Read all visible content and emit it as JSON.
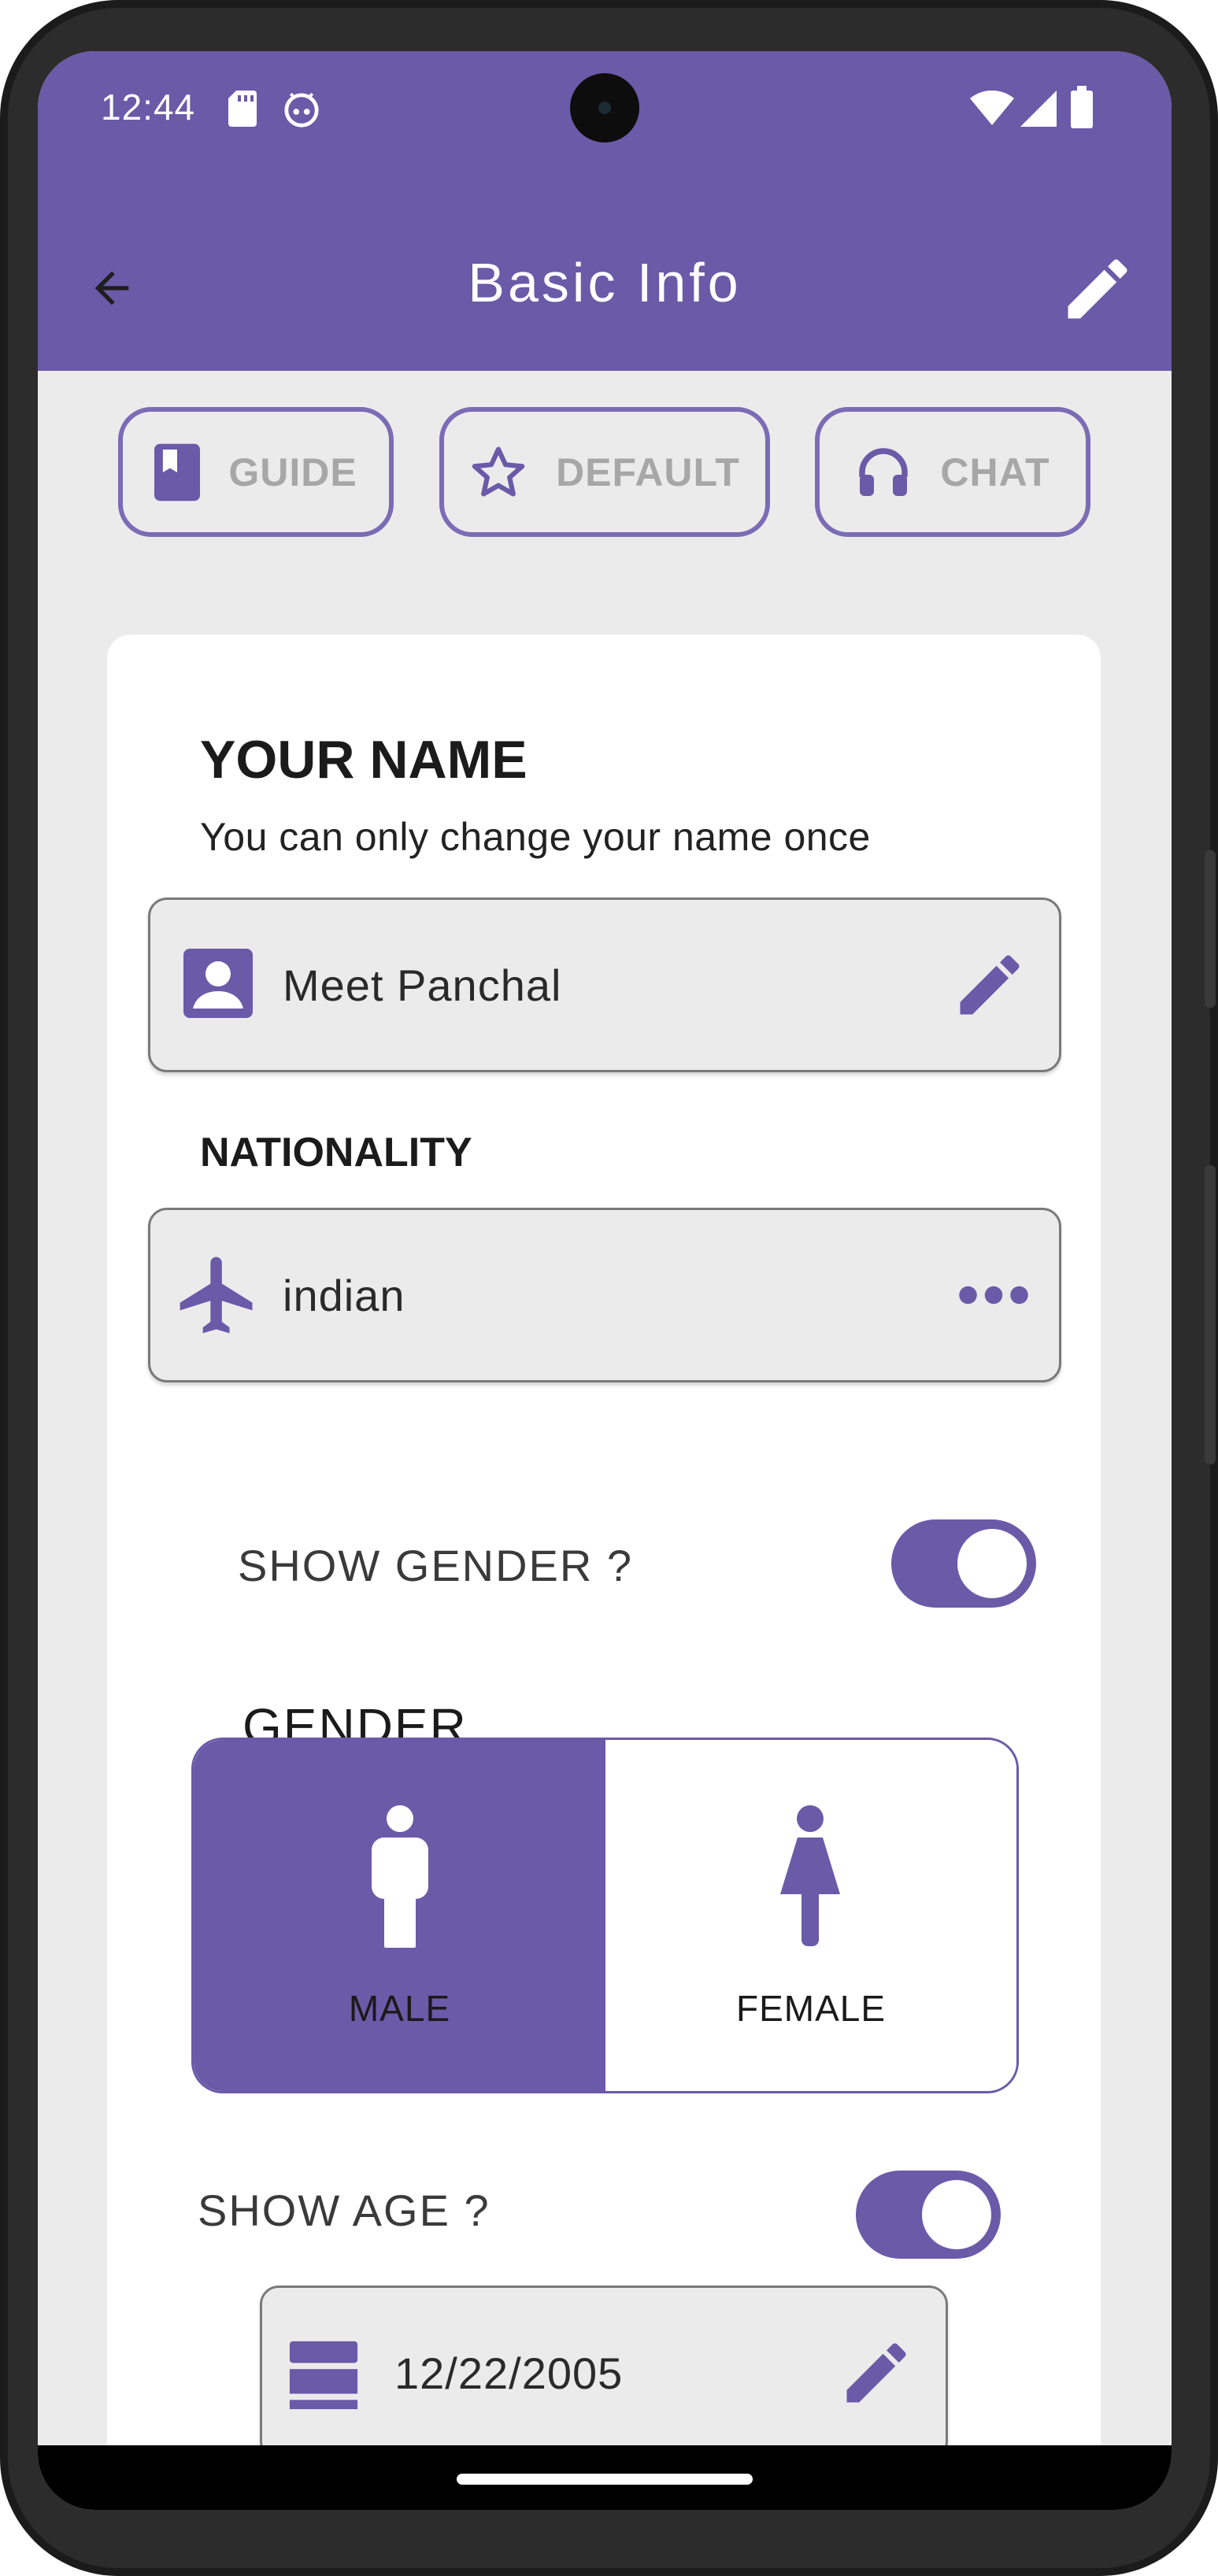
{
  "status_bar": {
    "time": "12:44"
  },
  "app_bar": {
    "title": "Basic Info"
  },
  "quick_actions": {
    "guide": "GUIDE",
    "default": "DEFAULT",
    "chat": "CHAT"
  },
  "name_section": {
    "heading": "YOUR NAME",
    "hint": "You can only change your name once",
    "value": "Meet Panchal"
  },
  "nationality_section": {
    "heading": "NATIONALITY",
    "value": "indian"
  },
  "gender_section": {
    "show_label": "SHOW GENDER ?",
    "show_enabled": true,
    "heading": "GENDER",
    "options": [
      "MALE",
      "FEMALE"
    ],
    "selected": "MALE"
  },
  "age_section": {
    "show_label": "SHOW AGE ?",
    "show_enabled": true,
    "dob": "12/22/2005"
  },
  "colors": {
    "primary": "#6a5aa8",
    "background": "#ebebeb"
  }
}
